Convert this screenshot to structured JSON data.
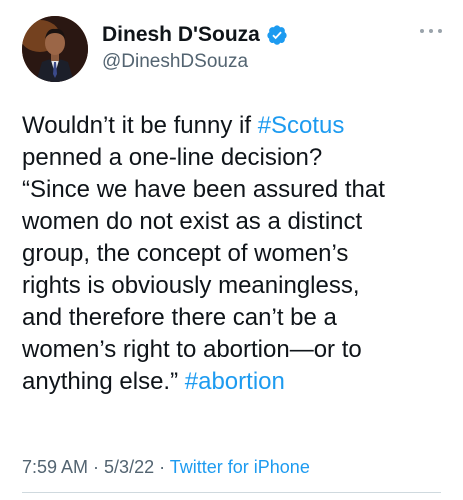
{
  "author": {
    "display_name": "Dinesh D'Souza",
    "handle": "@DineshDSouza",
    "verified": true,
    "avatar_icon": "profile-photo"
  },
  "tweet": {
    "text_intro": "Wouldn’t it be funny if ",
    "hashtag_1": "#Scotus",
    "text_body": "\npenned a one-line decision?\n“Since we have been assured that\nwomen do not exist as a distinct\ngroup, the concept of women’s\nrights is obviously meaningless,\nand therefore there can’t be a\nwomen’s right to abortion—or to\nanything else.” ",
    "hashtag_2": "#abortion"
  },
  "meta": {
    "time": "7:59 AM",
    "separator_1": " · ",
    "date": "5/3/22",
    "separator_2": " · ",
    "source": "Twitter for iPhone"
  },
  "colors": {
    "link": "#1d9bf0",
    "secondary_text": "#536471",
    "primary_text": "#0f1419"
  },
  "icons": {
    "verified": "verified-badge-icon",
    "more": "more-options-icon"
  }
}
